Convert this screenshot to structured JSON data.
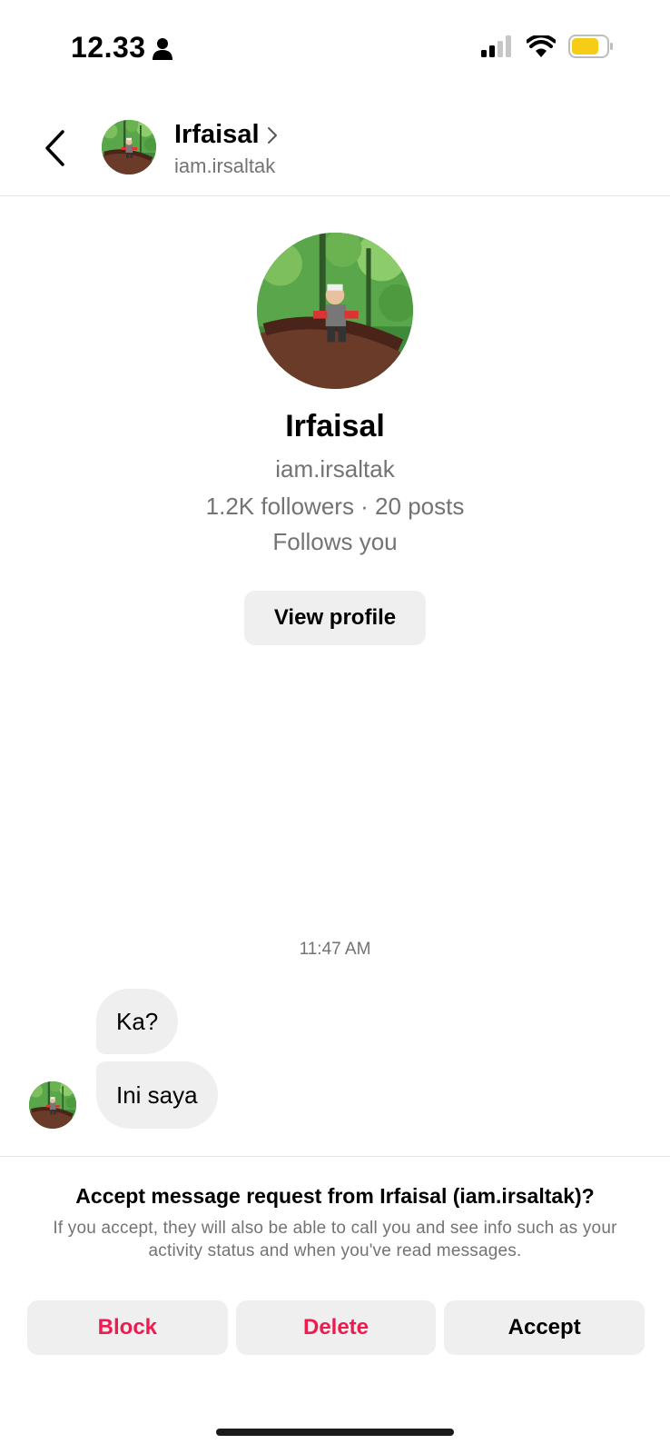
{
  "status_bar": {
    "time": "12.33",
    "icons": [
      "person-icon",
      "signal-icon",
      "wifi-icon",
      "battery-icon"
    ],
    "battery_color": "#f7cc17"
  },
  "header": {
    "back_icon": "chevron-left-icon",
    "name": "Irfaisal",
    "chevron": "›",
    "username": "iam.irsaltak"
  },
  "profile": {
    "name": "Irfaisal",
    "username": "iam.irsaltak",
    "stats": "1.2K followers · 20 posts",
    "follows": "Follows you",
    "view_profile_label": "View profile"
  },
  "conversation": {
    "timestamp": "11:47 AM",
    "messages": [
      {
        "text": "Ka?"
      },
      {
        "text": "Ini saya"
      }
    ]
  },
  "request": {
    "title": "Accept message request from Irfaisal (iam.irsaltak)?",
    "description": "If you accept, they will also be able to call you and see info such as your activity status and when you've read messages.",
    "actions": {
      "block": "Block",
      "delete": "Delete",
      "accept": "Accept"
    },
    "danger_color": "#ed1b4f"
  }
}
